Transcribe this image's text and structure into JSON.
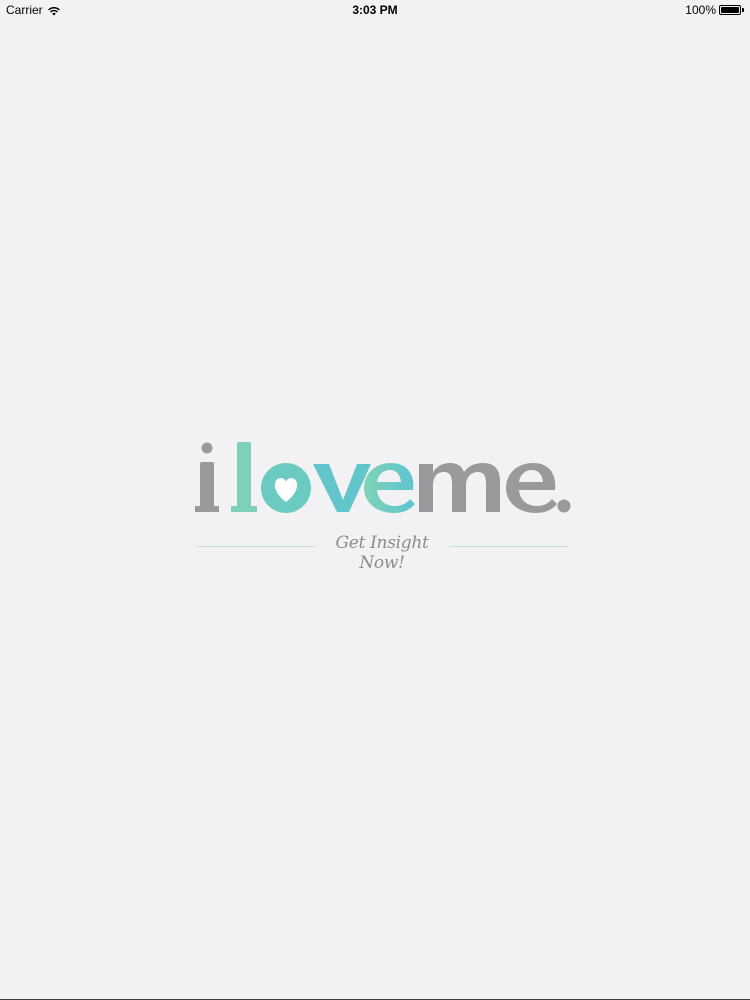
{
  "status_bar": {
    "carrier": "Carrier",
    "time": "3:03 PM",
    "battery": "100%",
    "battery_level": 1.0,
    "wifi_icon": "wifi-icon",
    "battery_icon": "battery-icon"
  },
  "logo": {
    "text": "iloveme.",
    "tagline": "Get Insight Now!",
    "colors": {
      "gray": "#9a9a9c",
      "teal_light": "#7fd0c3",
      "teal": "#5fc6c9",
      "line": "#bfe3dc"
    }
  }
}
